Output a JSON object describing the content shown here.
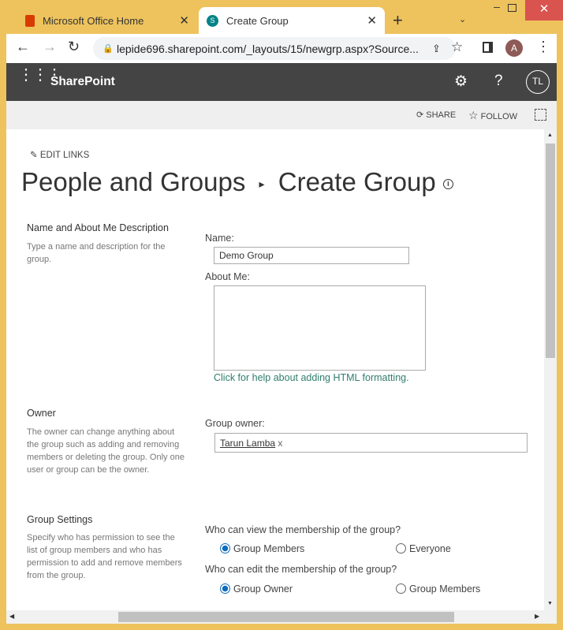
{
  "browser": {
    "tabs": [
      {
        "title": "Microsoft Office Home"
      },
      {
        "title": "Create Group"
      }
    ],
    "url": "lepide696.sharepoint.com/_layouts/15/newgrp.aspx?Source...",
    "profile_initial": "A"
  },
  "suite": {
    "app_name": "SharePoint",
    "user_initials": "TL"
  },
  "commands": {
    "share": "SHARE",
    "follow": "FOLLOW"
  },
  "page": {
    "edit_links": "EDIT LINKS",
    "breadcrumb_parent": "People and Groups",
    "title": "Create Group"
  },
  "sections": {
    "name": {
      "heading": "Name and About Me Description",
      "desc": "Type a name and description for the group.",
      "name_label": "Name:",
      "name_value": "Demo Group",
      "about_label": "About Me:",
      "about_value": "",
      "help_link": "Click for help about adding HTML formatting."
    },
    "owner": {
      "heading": "Owner",
      "desc": "The owner can change anything about the group such as adding and removing members or deleting the group. Only one user or group can be the owner.",
      "label": "Group owner:",
      "value": "Tarun Lamba",
      "remove": "x"
    },
    "settings": {
      "heading": "Group Settings",
      "desc": "Specify who has permission to see the list of group members and who has permission to add and remove members from the group.",
      "q1": "Who can view the membership of the group?",
      "q1_opt1": "Group Members",
      "q1_opt2": "Everyone",
      "q2": "Who can edit the membership of the group?",
      "q2_opt1": "Group Owner",
      "q2_opt2": "Group Members"
    }
  }
}
